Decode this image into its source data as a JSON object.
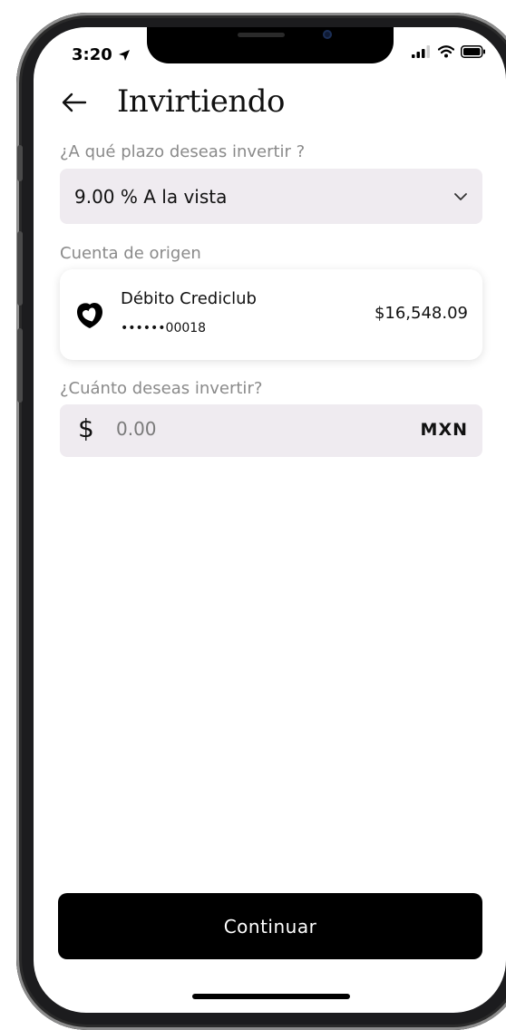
{
  "status_bar": {
    "time": "3:20"
  },
  "header": {
    "title": "Invirtiendo"
  },
  "term_field": {
    "label": "¿A qué plazo deseas invertir ?",
    "selected_value": "9.00 % A la vista"
  },
  "source_account": {
    "label": "Cuenta de origen",
    "name": "Débito Crediclub",
    "number": "••••••00018",
    "balance": "$16,548.09"
  },
  "amount_field": {
    "label": "¿Cuánto deseas invertir?",
    "currency_symbol": "$",
    "placeholder": "0.00",
    "currency": "MXN"
  },
  "continue_button": {
    "label": "Continuar"
  },
  "colors": {
    "input_background": "#efebf0",
    "button_background": "#000000",
    "label_gray": "#8a8a8a"
  },
  "icons": [
    "back-arrow-icon",
    "location-arrow-icon",
    "signal-icon",
    "wifi-icon",
    "battery-icon",
    "chevron-down-icon",
    "crediclub-logo-icon"
  ]
}
